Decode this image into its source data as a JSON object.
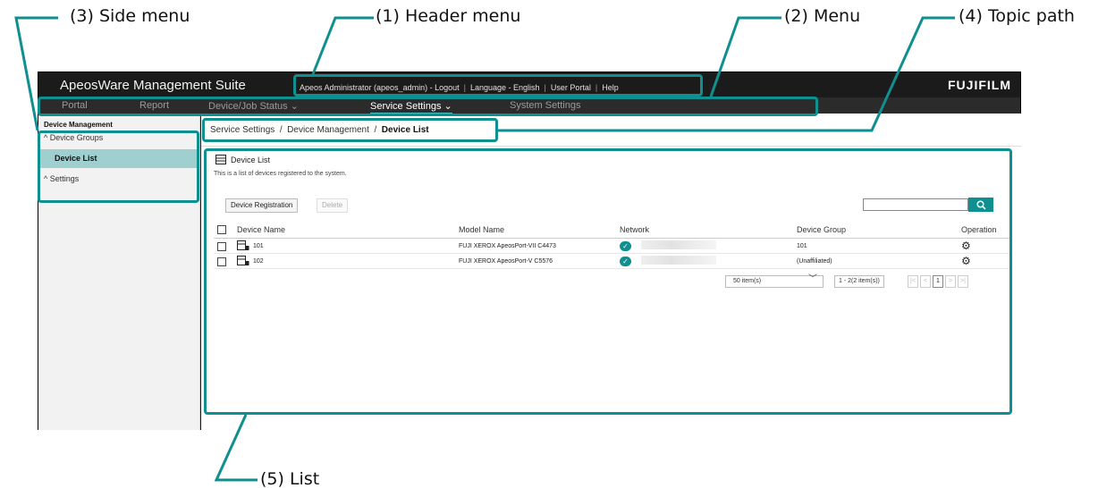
{
  "callouts": {
    "side_menu": "(3) Side menu",
    "header_menu": "(1) Header menu",
    "menu": "(2) Menu",
    "topic_path": "(4) Topic path",
    "list": "(5) List"
  },
  "colors": {
    "accent": "#0f8f8f",
    "selected_side": "#9fcfcf",
    "header_bg": "#1b1b1b"
  },
  "app": {
    "title": "ApeosWare Management Suite",
    "brand": "FUJIFILM",
    "header_menu": {
      "user": "Apeos Administrator (apeos_admin) - Logout",
      "language": "Language - English",
      "portal": "User Portal",
      "help": "Help",
      "separator": "|"
    },
    "nav": {
      "portal": "Portal",
      "report": "Report",
      "device_job_status": "Device/Job Status ⌄",
      "service_settings": "Service Settings ⌄",
      "system_settings": "System Settings"
    },
    "side": {
      "title": "Device Management",
      "device_groups": "^ Device Groups",
      "device_list": "Device List",
      "settings": "^ Settings"
    },
    "breadcrumb": {
      "part1": "Service Settings",
      "part2": "Device Management",
      "current": "Device List",
      "sep": "/"
    },
    "list": {
      "heading": "Device List",
      "icon": "device-list-icon",
      "description": "This is a list of devices registered to the system.",
      "register_button": "Device Registration",
      "delete_button": "Delete",
      "search_placeholder": "",
      "columns": {
        "device_name": "Device Name",
        "model_name": "Model Name",
        "network": "Network",
        "device_group": "Device Group",
        "operation": "Operation"
      },
      "rows": [
        {
          "name": "101",
          "model": "FUJI XEROX ApeosPort-VII C4473",
          "group": "101",
          "network_ok": "✓"
        },
        {
          "name": "102",
          "model": "FUJI XEROX ApeosPort-V C5576",
          "group": "(Unaffiliated)",
          "network_ok": "✓"
        }
      ],
      "pager": {
        "page_size": "50 item(s)",
        "range": "1 - 2(2 item(s))",
        "first": "|<",
        "prev": "<",
        "current": "1",
        "next": ">",
        "last": ">|"
      }
    }
  }
}
